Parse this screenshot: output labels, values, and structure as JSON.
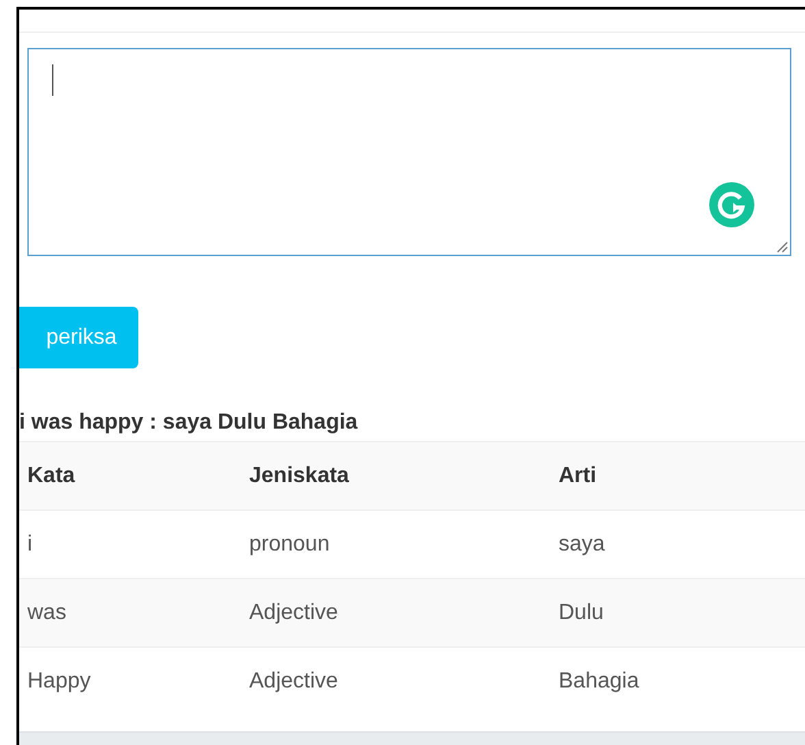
{
  "editor": {
    "focused": true
  },
  "submit_button": {
    "label": "periksa"
  },
  "result_heading": "i was happy : saya Dulu Bahagia",
  "table": {
    "columns": [
      "Kata",
      "Jeniskata",
      "Arti"
    ],
    "rows": [
      [
        "i",
        "pronoun",
        "saya"
      ],
      [
        "was",
        "Adjective",
        "Dulu"
      ],
      [
        "Happy",
        "Adjective",
        "Bahagia"
      ]
    ]
  }
}
